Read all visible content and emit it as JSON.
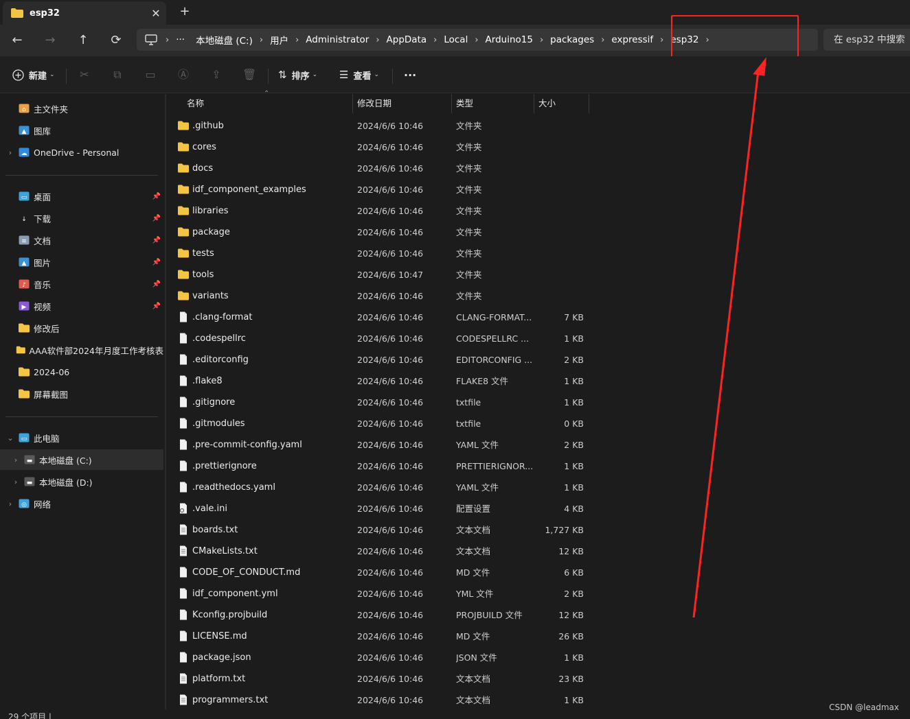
{
  "tab": {
    "title": "esp32",
    "close": "✕",
    "new_tab": "+"
  },
  "nav": {
    "back": "←",
    "forward": "→",
    "up": "↑",
    "refresh": "⟳"
  },
  "address": {
    "more": "···",
    "crumbs": [
      "本地磁盘 (C:)",
      "用户",
      "Administrator",
      "AppData",
      "Local",
      "Arduino15",
      "packages",
      "expressif",
      "esp32"
    ],
    "search_placeholder": "在 esp32 中搜索"
  },
  "commands": {
    "new": "新建",
    "sort": "排序",
    "view": "查看",
    "more": "···"
  },
  "sidebar": {
    "quick": [
      {
        "label": "主文件夹",
        "icon": "home-icon"
      },
      {
        "label": "图库",
        "icon": "gallery-icon"
      },
      {
        "label": "OneDrive - Personal",
        "icon": "onedrive-icon"
      }
    ],
    "pinned": [
      {
        "label": "桌面",
        "icon": "desktop-icon",
        "pinned": true
      },
      {
        "label": "下载",
        "icon": "download-icon",
        "pinned": true
      },
      {
        "label": "文档",
        "icon": "documents-icon",
        "pinned": true
      },
      {
        "label": "图片",
        "icon": "pictures-icon",
        "pinned": true
      },
      {
        "label": "音乐",
        "icon": "music-icon",
        "pinned": true
      },
      {
        "label": "视频",
        "icon": "videos-icon",
        "pinned": true
      },
      {
        "label": "修改后",
        "icon": "folder-icon",
        "pinned": false
      },
      {
        "label": "AAA软件部2024年月度工作考核表",
        "icon": "folder-icon",
        "pinned": false
      },
      {
        "label": "2024-06",
        "icon": "folder-icon",
        "pinned": false
      },
      {
        "label": "屏幕截图",
        "icon": "folder-icon",
        "pinned": false
      }
    ],
    "this_pc": "此电脑",
    "drives": [
      "本地磁盘 (C:)",
      "本地磁盘 (D:)"
    ],
    "network": "网络"
  },
  "columns": {
    "name": "名称",
    "date": "修改日期",
    "type": "类型",
    "size": "大小"
  },
  "files": [
    {
      "name": ".github",
      "date": "2024/6/6 10:46",
      "type": "文件夹",
      "size": "",
      "kind": "folder"
    },
    {
      "name": "cores",
      "date": "2024/6/6 10:46",
      "type": "文件夹",
      "size": "",
      "kind": "folder"
    },
    {
      "name": "docs",
      "date": "2024/6/6 10:46",
      "type": "文件夹",
      "size": "",
      "kind": "folder"
    },
    {
      "name": "idf_component_examples",
      "date": "2024/6/6 10:46",
      "type": "文件夹",
      "size": "",
      "kind": "folder"
    },
    {
      "name": "libraries",
      "date": "2024/6/6 10:46",
      "type": "文件夹",
      "size": "",
      "kind": "folder"
    },
    {
      "name": "package",
      "date": "2024/6/6 10:46",
      "type": "文件夹",
      "size": "",
      "kind": "folder"
    },
    {
      "name": "tests",
      "date": "2024/6/6 10:46",
      "type": "文件夹",
      "size": "",
      "kind": "folder"
    },
    {
      "name": "tools",
      "date": "2024/6/6 10:47",
      "type": "文件夹",
      "size": "",
      "kind": "folder"
    },
    {
      "name": "variants",
      "date": "2024/6/6 10:46",
      "type": "文件夹",
      "size": "",
      "kind": "folder"
    },
    {
      "name": ".clang-format",
      "date": "2024/6/6 10:46",
      "type": "CLANG-FORMAT...",
      "size": "7 KB",
      "kind": "file"
    },
    {
      "name": ".codespellrc",
      "date": "2024/6/6 10:46",
      "type": "CODESPELLRC ...",
      "size": "1 KB",
      "kind": "file"
    },
    {
      "name": ".editorconfig",
      "date": "2024/6/6 10:46",
      "type": "EDITORCONFIG ...",
      "size": "2 KB",
      "kind": "file"
    },
    {
      "name": ".flake8",
      "date": "2024/6/6 10:46",
      "type": "FLAKE8 文件",
      "size": "1 KB",
      "kind": "file"
    },
    {
      "name": ".gitignore",
      "date": "2024/6/6 10:46",
      "type": "txtfile",
      "size": "1 KB",
      "kind": "file"
    },
    {
      "name": ".gitmodules",
      "date": "2024/6/6 10:46",
      "type": "txtfile",
      "size": "0 KB",
      "kind": "file"
    },
    {
      "name": ".pre-commit-config.yaml",
      "date": "2024/6/6 10:46",
      "type": "YAML 文件",
      "size": "2 KB",
      "kind": "file"
    },
    {
      "name": ".prettierignore",
      "date": "2024/6/6 10:46",
      "type": "PRETTIERIGNOR...",
      "size": "1 KB",
      "kind": "file"
    },
    {
      "name": ".readthedocs.yaml",
      "date": "2024/6/6 10:46",
      "type": "YAML 文件",
      "size": "1 KB",
      "kind": "file"
    },
    {
      "name": ".vale.ini",
      "date": "2024/6/6 10:46",
      "type": "配置设置",
      "size": "4 KB",
      "kind": "config"
    },
    {
      "name": "boards.txt",
      "date": "2024/6/6 10:46",
      "type": "文本文档",
      "size": "1,727 KB",
      "kind": "text"
    },
    {
      "name": "CMakeLists.txt",
      "date": "2024/6/6 10:46",
      "type": "文本文档",
      "size": "12 KB",
      "kind": "text"
    },
    {
      "name": "CODE_OF_CONDUCT.md",
      "date": "2024/6/6 10:46",
      "type": "MD 文件",
      "size": "6 KB",
      "kind": "file"
    },
    {
      "name": "idf_component.yml",
      "date": "2024/6/6 10:46",
      "type": "YML 文件",
      "size": "2 KB",
      "kind": "file"
    },
    {
      "name": "Kconfig.projbuild",
      "date": "2024/6/6 10:46",
      "type": "PROJBUILD 文件",
      "size": "12 KB",
      "kind": "file"
    },
    {
      "name": "LICENSE.md",
      "date": "2024/6/6 10:46",
      "type": "MD 文件",
      "size": "26 KB",
      "kind": "file"
    },
    {
      "name": "package.json",
      "date": "2024/6/6 10:46",
      "type": "JSON 文件",
      "size": "1 KB",
      "kind": "file"
    },
    {
      "name": "platform.txt",
      "date": "2024/6/6 10:46",
      "type": "文本文档",
      "size": "23 KB",
      "kind": "text"
    },
    {
      "name": "programmers.txt",
      "date": "2024/6/6 10:46",
      "type": "文本文档",
      "size": "1 KB",
      "kind": "text"
    }
  ],
  "status": "29 个项目  |",
  "watermark": "CSDN @leadmax",
  "colors": {
    "folder": "#f4c542",
    "highlight": "#ff2222",
    "background": "#1c1c1c"
  }
}
